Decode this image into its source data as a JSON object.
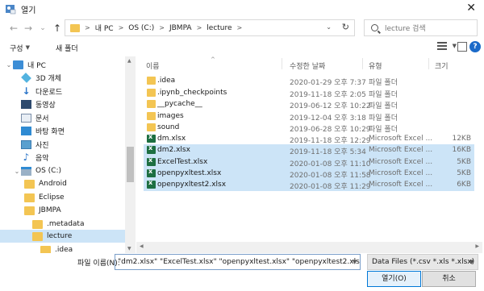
{
  "window": {
    "title": "열기",
    "close": "✕"
  },
  "nav": {
    "back": "←",
    "forward": "→",
    "recent": "⌄",
    "up": "↑"
  },
  "address": {
    "crumbs": [
      "내 PC",
      "OS (C:)",
      "JBMPA",
      "lecture"
    ],
    "sep": ">",
    "dropdown": "⌄",
    "refresh": "↻"
  },
  "search": {
    "placeholder": "lecture 검색"
  },
  "toolbar": {
    "organize": "구성",
    "new_folder": "새 폴더",
    "help": "?"
  },
  "sidebar": {
    "items": [
      {
        "label": "내 PC",
        "icon": "computer-icon",
        "selected": false
      },
      {
        "label": "3D 개체",
        "icon": "cube-icon",
        "selected": false
      },
      {
        "label": "다운로드",
        "icon": "download-icon",
        "selected": false
      },
      {
        "label": "동영상",
        "icon": "video-icon",
        "selected": false
      },
      {
        "label": "문서",
        "icon": "document-icon",
        "selected": false
      },
      {
        "label": "바탕 화면",
        "icon": "desktop-icon",
        "selected": false
      },
      {
        "label": "사진",
        "icon": "picture-icon",
        "selected": false
      },
      {
        "label": "음악",
        "icon": "music-icon",
        "selected": false
      },
      {
        "label": "OS (C:)",
        "icon": "drive-icon",
        "selected": false
      },
      {
        "label": "Android",
        "icon": "folder-icon",
        "selected": false
      },
      {
        "label": "Eclipse",
        "icon": "folder-icon",
        "selected": false
      },
      {
        "label": "JBMPA",
        "icon": "folder-icon",
        "selected": false
      },
      {
        "label": ".metadata",
        "icon": "folder-icon",
        "selected": false
      },
      {
        "label": "lecture",
        "icon": "folder-icon",
        "selected": true
      },
      {
        "label": ".idea",
        "icon": "folder-icon",
        "selected": false
      }
    ]
  },
  "columns": {
    "name": "이름",
    "date": "수정한 날짜",
    "type": "유형",
    "size": "크기"
  },
  "files": [
    {
      "name": ".idea",
      "date": "2020-01-29 오후 7:37",
      "type": "파일 폴더",
      "size": "",
      "kind": "folder",
      "selected": false
    },
    {
      "name": ".ipynb_checkpoints",
      "date": "2019-11-18 오후 2:05",
      "type": "파일 폴더",
      "size": "",
      "kind": "folder",
      "selected": false
    },
    {
      "name": "__pycache__",
      "date": "2019-06-12 오후 10:22",
      "type": "파일 폴더",
      "size": "",
      "kind": "folder",
      "selected": false
    },
    {
      "name": "images",
      "date": "2019-12-04 오후 3:18",
      "type": "파일 폴더",
      "size": "",
      "kind": "folder",
      "selected": false
    },
    {
      "name": "sound",
      "date": "2019-06-28 오후 10:29",
      "type": "파일 폴더",
      "size": "",
      "kind": "folder",
      "selected": false
    },
    {
      "name": "dm.xlsx",
      "date": "2019-11-18 오후 12:29",
      "type": "Microsoft Excel ...",
      "size": "12KB",
      "kind": "excel",
      "selected": false
    },
    {
      "name": "dm2.xlsx",
      "date": "2019-11-18 오후 5:34",
      "type": "Microsoft Excel ...",
      "size": "16KB",
      "kind": "excel",
      "selected": true
    },
    {
      "name": "ExcelTest.xlsx",
      "date": "2020-01-08 오후 11:10",
      "type": "Microsoft Excel ...",
      "size": "5KB",
      "kind": "excel",
      "selected": true
    },
    {
      "name": "openpyxltest.xlsx",
      "date": "2020-01-08 오후 11:58",
      "type": "Microsoft Excel ...",
      "size": "5KB",
      "kind": "excel",
      "selected": true
    },
    {
      "name": "openpyxltest2.xlsx",
      "date": "2020-01-08 오후 11:29",
      "type": "Microsoft Excel ...",
      "size": "6KB",
      "kind": "excel",
      "selected": true
    }
  ],
  "footer": {
    "filename_label": "파일 이름(N):",
    "filename_value": "\"dm2.xlsx\" \"ExcelTest.xlsx\" \"openpyxltest.xlsx\" \"openpyxltest2.xlsx\"",
    "filter_value": "Data Files (*.csv *.xls *.xlsx)",
    "open_label": "열기(O)",
    "cancel_label": "취소"
  },
  "colors": {
    "selection": "#cce4f7",
    "accent": "#0078d7",
    "folder": "#f3c553",
    "excel": "#1d6f42"
  }
}
